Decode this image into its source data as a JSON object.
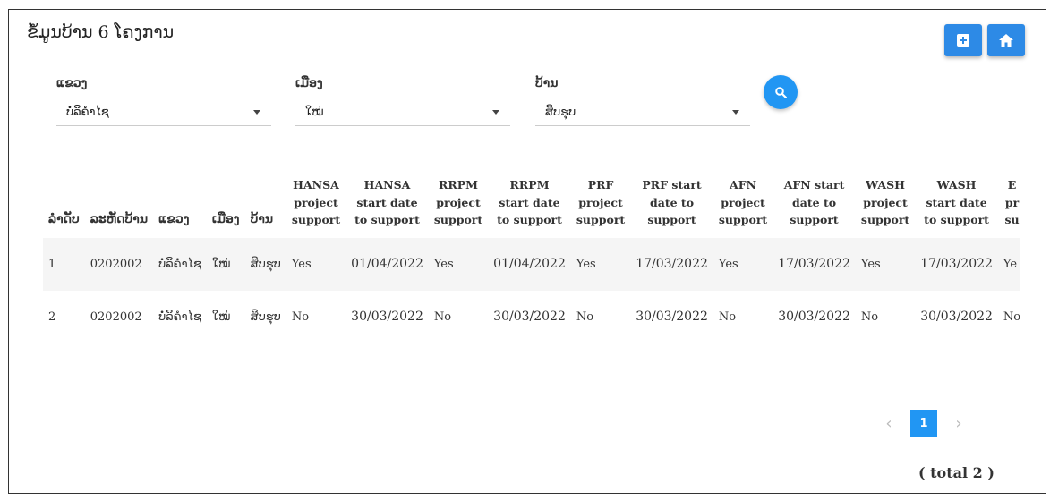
{
  "page": {
    "title": "ຂໍ້ມູນບ້ານ 6 ໂຄງການ"
  },
  "filters": {
    "province": {
      "label": "ແຂວງ",
      "value": "ບໍ່ລິຄຳໄຊ"
    },
    "district": {
      "label": "ເມືອງ",
      "value": "ໃໝ່"
    },
    "village": {
      "label": "ບ້ານ",
      "value": "ສິບຮຸບ"
    }
  },
  "table": {
    "headers": {
      "no": "ລຳດັບ",
      "village_code": "ລະຫັດບ້ານ",
      "province": "ແຂວງ",
      "district": "ເມືອງ",
      "village": "ບ້ານ",
      "hansa_support": [
        "HANSA",
        "project",
        "support"
      ],
      "hansa_date": [
        "HANSA",
        "start date",
        "to support"
      ],
      "rrpm_support": [
        "RRPM",
        "project",
        "support"
      ],
      "rrpm_date": [
        "RRPM",
        "start date",
        "to support"
      ],
      "prf_support": [
        "PRF",
        "project",
        "support"
      ],
      "prf_date": [
        "PRF start",
        "date to",
        "support"
      ],
      "afn_support": [
        "AFN",
        "project",
        "support"
      ],
      "afn_date": [
        "AFN start",
        "date to",
        "support"
      ],
      "wash_support": [
        "WASH",
        "project",
        "support"
      ],
      "wash_date": [
        "WASH",
        "start date",
        "to support"
      ],
      "extra": [
        "E",
        "pr",
        "su"
      ]
    },
    "rows": [
      {
        "no": "1",
        "village_code": "0202002",
        "province": "ບໍ່ລິຄຳໄຊ",
        "district": "ໃໝ່",
        "village": "ສິບຮຸບ",
        "hansa_support": "Yes",
        "hansa_date": "01/04/2022",
        "rrpm_support": "Yes",
        "rrpm_date": "01/04/2022",
        "prf_support": "Yes",
        "prf_date": "17/03/2022",
        "afn_support": "Yes",
        "afn_date": "17/03/2022",
        "wash_support": "Yes",
        "wash_date": "17/03/2022",
        "extra": "Ye"
      },
      {
        "no": "2",
        "village_code": "0202002",
        "province": "ບໍ່ລິຄຳໄຊ",
        "district": "ໃໝ່",
        "village": "ສິບຮຸບ",
        "hansa_support": "No",
        "hansa_date": "30/03/2022",
        "rrpm_support": "No",
        "rrpm_date": "30/03/2022",
        "prf_support": "No",
        "prf_date": "30/03/2022",
        "afn_support": "No",
        "afn_date": "30/03/2022",
        "wash_support": "No",
        "wash_date": "30/03/2022",
        "extra": "No"
      }
    ]
  },
  "pagination": {
    "prev": "‹",
    "current": "1",
    "next": "›",
    "total_label": "( total 2 )"
  },
  "icons": {
    "add": "plus-square-icon",
    "home": "home-icon",
    "search": "search-icon"
  },
  "colors": {
    "primary": "#2196f3",
    "button": "#2d8ae6"
  }
}
